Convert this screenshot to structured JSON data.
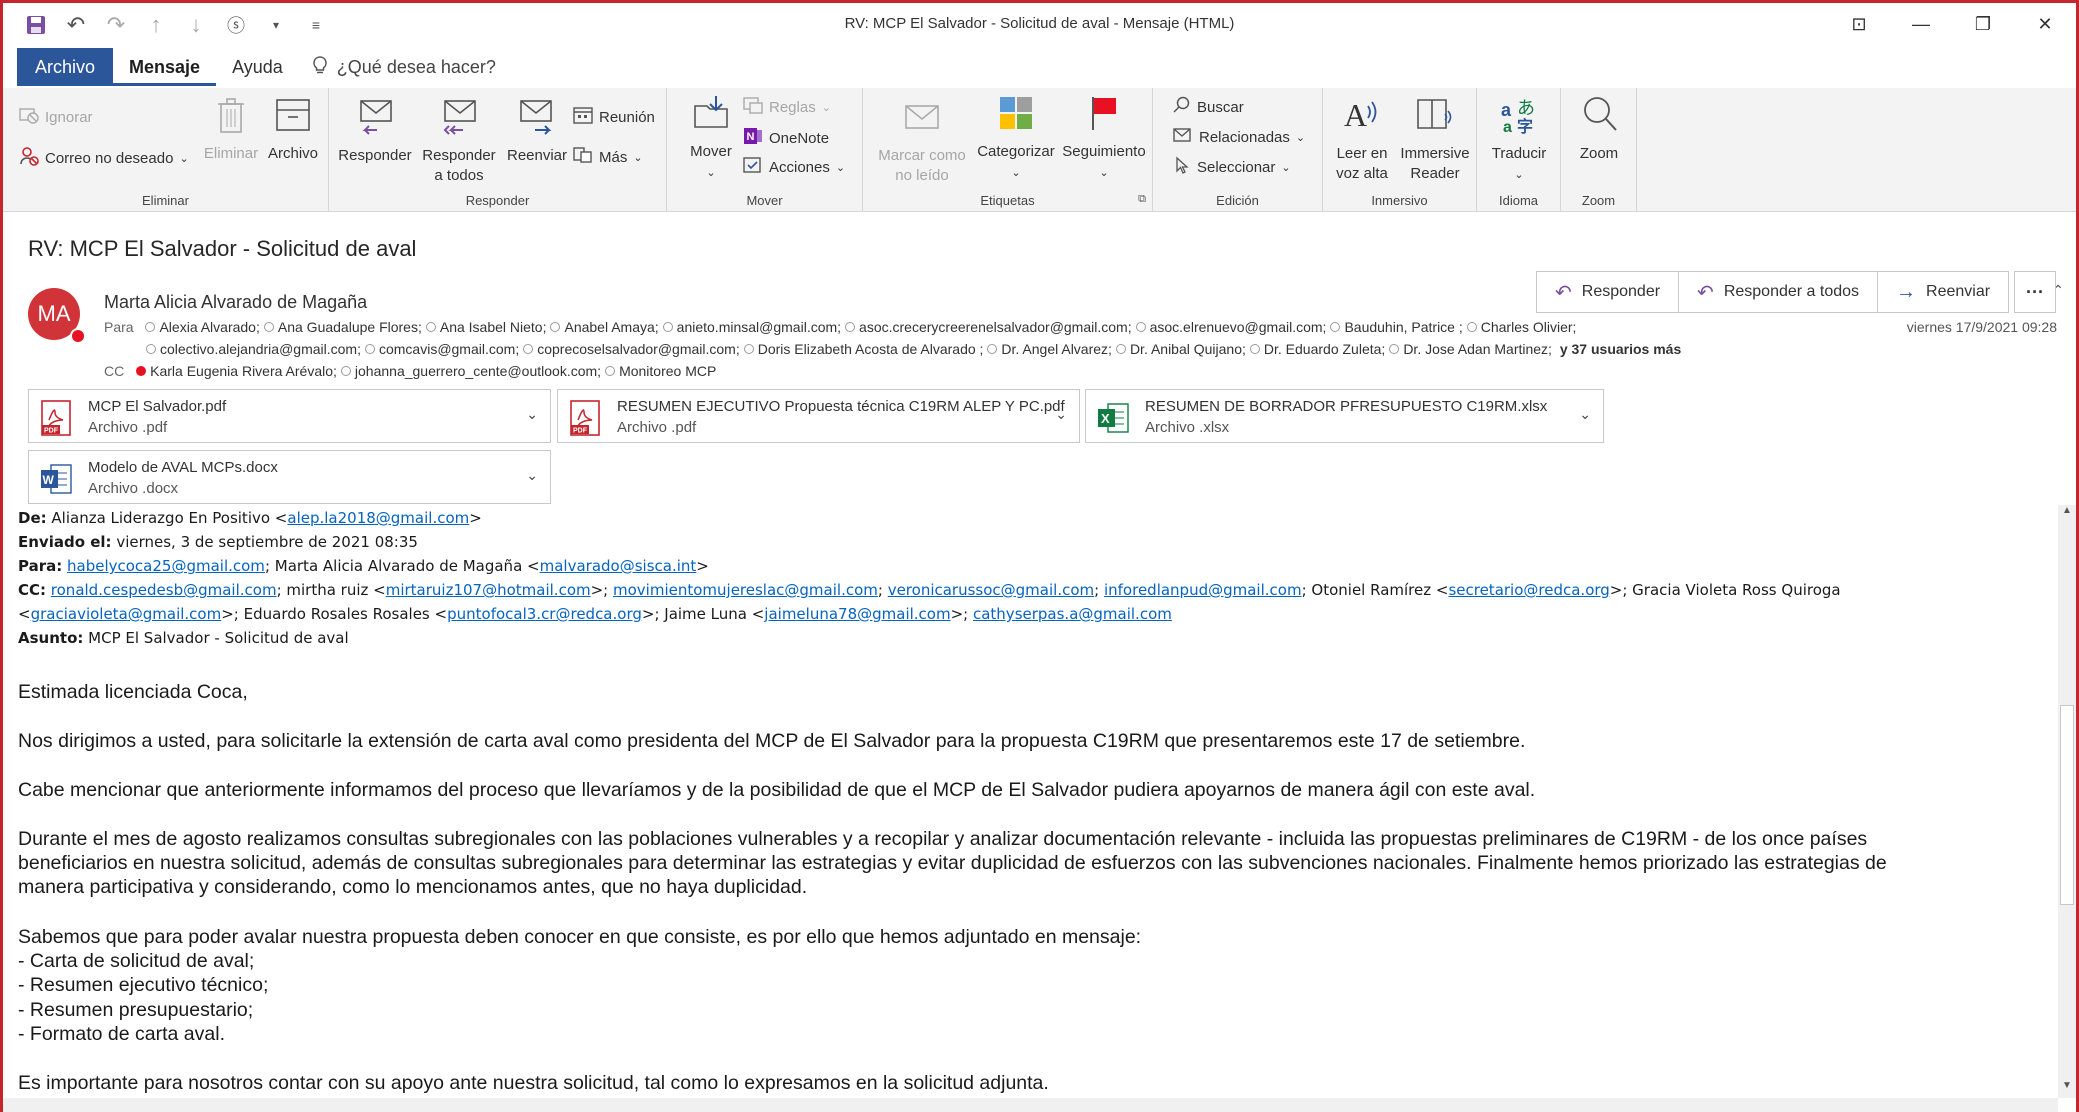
{
  "window": {
    "title": "RV: MCP El Salvador - Solicitud de aval  -  Mensaje (HTML)"
  },
  "tabs": {
    "file": "Archivo",
    "message": "Mensaje",
    "help": "Ayuda",
    "tell_me": "¿Qué desea hacer?"
  },
  "ribbon": {
    "ignore": "Ignorar",
    "junk": "Correo no deseado",
    "delete": "Eliminar",
    "archive": "Archivo",
    "group_delete": "Eliminar",
    "reply": "Responder",
    "reply_all_1": "Responder",
    "reply_all_2": "a todos",
    "forward": "Reenviar",
    "meeting": "Reunión",
    "more": "Más",
    "group_respond": "Responder",
    "move": "Mover",
    "rules": "Reglas",
    "onenote": "OneNote",
    "actions": "Acciones",
    "group_move": "Mover",
    "mark_unread_1": "Marcar como",
    "mark_unread_2": "no leído",
    "categorize": "Categorizar",
    "follow_up": "Seguimiento",
    "group_tags": "Etiquetas",
    "find": "Buscar",
    "related": "Relacionadas",
    "select": "Seleccionar",
    "group_edit": "Edición",
    "read_aloud_1": "Leer en",
    "read_aloud_2": "voz alta",
    "immersive_1": "Immersive",
    "immersive_2": "Reader",
    "group_immersive": "Inmersivo",
    "translate": "Traducir",
    "group_language": "Idioma",
    "zoom": "Zoom",
    "group_zoom": "Zoom"
  },
  "message": {
    "subject": "RV: MCP El Salvador - Solicitud de aval",
    "avatar_initials": "MA",
    "sender": "Marta Alicia Alvarado de Magaña",
    "date": "viernes 17/9/2021 09:28",
    "btn_reply": "Responder",
    "btn_reply_all": "Responder a todos",
    "btn_forward": "Reenviar",
    "to_label": "Para",
    "to_line1": [
      "Alexia Alvarado;",
      "Ana Guadalupe Flores;",
      "Ana Isabel Nieto;",
      "Anabel Amaya;",
      "anieto.minsal@gmail.com;",
      "asoc.crecerycreerenelsalvador@gmail.com;",
      "asoc.elrenuevo@gmail.com;",
      "Bauduhin, Patrice ;",
      "Charles Olivier;"
    ],
    "to_line2": [
      "colectivo.alejandria@gmail.com;",
      "comcavis@gmail.com;",
      "coprecoselsalvador@gmail.com;",
      "Doris Elizabeth Acosta de Alvarado ;",
      "Dr. Angel Alvarez;",
      "Dr. Anibal Quijano;",
      "Dr. Eduardo Zuleta;",
      "Dr. Jose Adan Martinez;"
    ],
    "more_users": "y 37 usuarios más",
    "cc_label": "CC",
    "cc": [
      "Karla Eugenia Rivera Arévalo;",
      "johanna_guerrero_cente@outlook.com;",
      "Monitoreo MCP"
    ]
  },
  "attachments": [
    {
      "name": "MCP El Salvador.pdf",
      "type": "Archivo .pdf",
      "icon": "pdf-icon"
    },
    {
      "name": "RESUMEN EJECUTIVO Propuesta técnica C19RM ALEP Y PC.pdf",
      "type": "Archivo .pdf",
      "icon": "pdf-icon"
    },
    {
      "name": "RESUMEN DE BORRADOR PFRESUPUESTO C19RM.xlsx",
      "type": "Archivo .xlsx",
      "icon": "excel-icon"
    },
    {
      "name": "Modelo de AVAL MCPs.docx",
      "type": "Archivo .docx",
      "icon": "word-icon"
    }
  ],
  "forwarded": {
    "from_label": "De:",
    "from_name": "Alianza Liderazgo En Positivo <",
    "from_email": "alep.la2018@gmail.com",
    "from_end": ">",
    "sent_label": "Enviado el:",
    "sent": "viernes, 3 de septiembre de 2021 08:35",
    "to_label": "Para:",
    "to_email1": "habelycoca25@gmail.com",
    "to_mid": "; Marta Alicia Alvarado de Magaña <",
    "to_email2": "malvarado@sisca.int",
    "to_end": ">",
    "cc_label": "CC:",
    "cc_e1": "ronald.cespedesb@gmail.com",
    "cc_t1": "; mirtha ruiz <",
    "cc_e2": "mirtaruiz107@hotmail.com",
    "cc_t2": ">; ",
    "cc_e3": "movimientomujereslac@gmail.com",
    "cc_t3": "; ",
    "cc_e4": "veronicarussoc@gmail.com",
    "cc_t4": "; ",
    "cc_e5": "inforedlanpud@gmail.com",
    "cc_t5": "; Otoniel Ramírez <",
    "cc_e6": "secretario@redca.org",
    "cc_t6": ">; Gracia Violeta Ross Quiroga",
    "cc2_t0": "<",
    "cc2_e1": "graciavioleta@gmail.com",
    "cc2_t1": ">; Eduardo Rosales Rosales <",
    "cc2_e2": "puntofocal3.cr@redca.org",
    "cc2_t2": ">; Jaime Luna <",
    "cc2_e3": "jaimeluna78@gmail.com",
    "cc2_t3": ">; ",
    "cc2_e4": "cathyserpas.a@gmail.com",
    "subject_label": "Asunto:",
    "subject": "MCP El Salvador - Solicitud de aval"
  },
  "body": {
    "greeting": "Estimada licenciada Coca,",
    "p1": "Nos dirigimos  a usted,  para solicitarle la extensión de carta aval como presidenta del MCP de El Salvador para la propuesta C19RM que presentaremos este 17 de setiembre.",
    "p2": "Cabe mencionar que anteriormente informamos del proceso que llevaríamos y de la posibilidad de que el MCP de El Salvador pudiera apoyarnos de manera ágil con este aval.",
    "p3_l1": "Durante el mes de agosto realizamos consultas subregionales con las poblaciones vulnerables y a recopilar y analizar documentación relevante - incluida las propuestas preliminares de C19RM - de los once países",
    "p3_l2": "beneficiarios en nuestra solicitud, además de consultas subregionales para determinar las estrategias y evitar duplicidad de esfuerzos con las subvenciones nacionales. Finalmente hemos priorizado las estrategias de",
    "p3_l3": "manera participativa y considerando, como lo mencionamos antes, que no haya duplicidad.",
    "p4": "Sabemos que para poder avalar nuestra propuesta deben conocer en que consiste, es por ello que hemos adjuntado en mensaje:",
    "list": [
      "- Carta de solicitud de aval;",
      "- Resumen ejecutivo técnico;",
      "- Resumen presupuestario;",
      "- Formato de carta aval."
    ],
    "p5": "Es importante para nosotros contar con su apoyo ante nuestra solicitud, tal como lo expresamos en la solicitud adjunta."
  }
}
